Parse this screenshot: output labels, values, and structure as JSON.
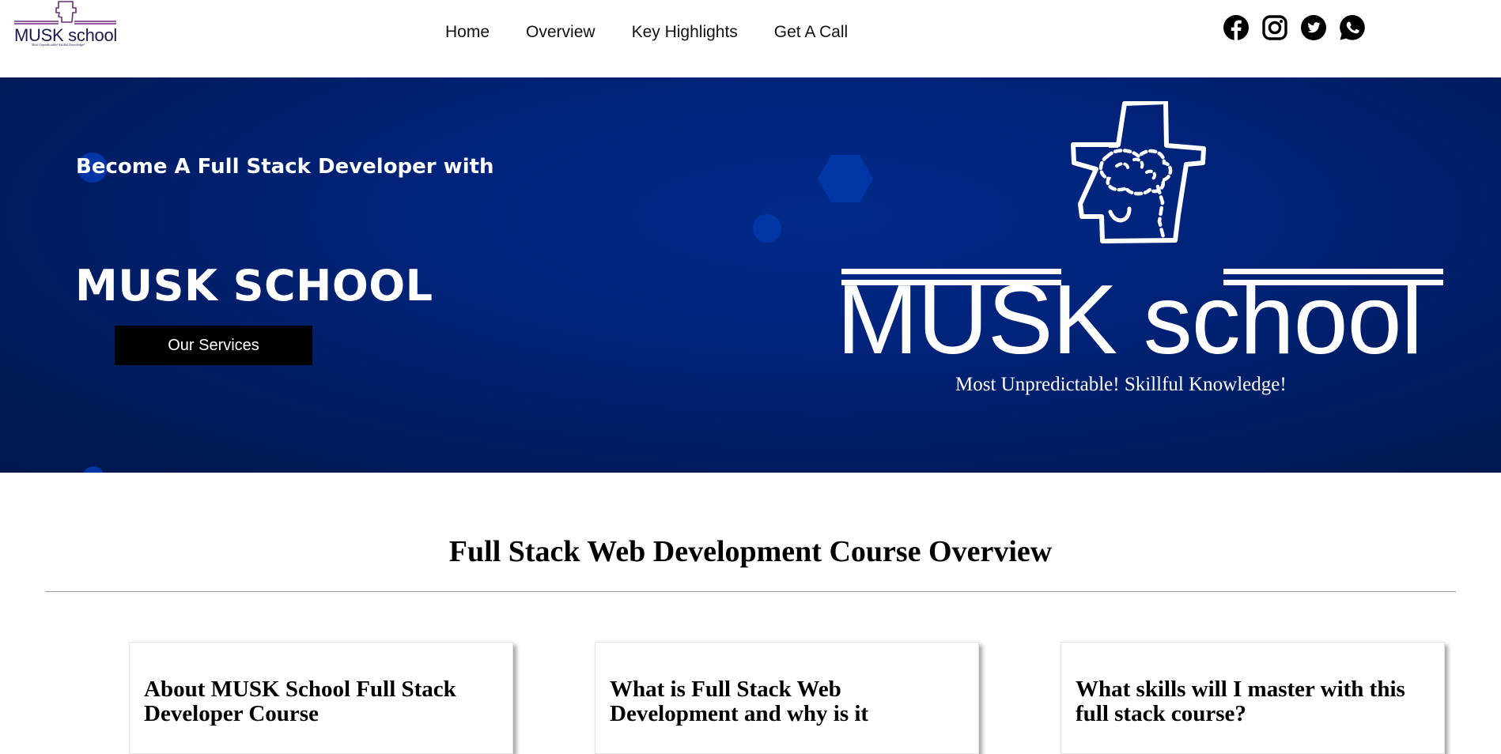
{
  "header": {
    "logo": {
      "name": "MUSK school",
      "tagline": "Most Unpredictable! Skillful Knowledge!"
    },
    "nav": [
      {
        "label": "Home"
      },
      {
        "label": "Overview"
      },
      {
        "label": "Key Highlights"
      },
      {
        "label": "Get A Call"
      }
    ],
    "socials": [
      {
        "icon": "facebook-icon"
      },
      {
        "icon": "instagram-icon"
      },
      {
        "icon": "twitter-icon"
      },
      {
        "icon": "whatsapp-icon"
      }
    ]
  },
  "hero": {
    "subtitle": "Become A Full Stack Developer with",
    "title": "MUSK SCHOOL",
    "button_label": "Our Services",
    "logo_text": "MUSK school",
    "logo_tagline": "Most Unpredictable! Skillful Knowledge!"
  },
  "overview": {
    "title": "Full Stack Web Development Course Overview",
    "cards": [
      {
        "title": "About MUSK School Full Stack Developer Course"
      },
      {
        "title": "What is Full Stack Web Development and why is it"
      },
      {
        "title": "What skills will I master with this full stack course?"
      }
    ]
  },
  "colors": {
    "hero_background": "#00237a",
    "button_background": "#000000",
    "text": "#000000",
    "accent_hexagon": "#0036a6"
  }
}
